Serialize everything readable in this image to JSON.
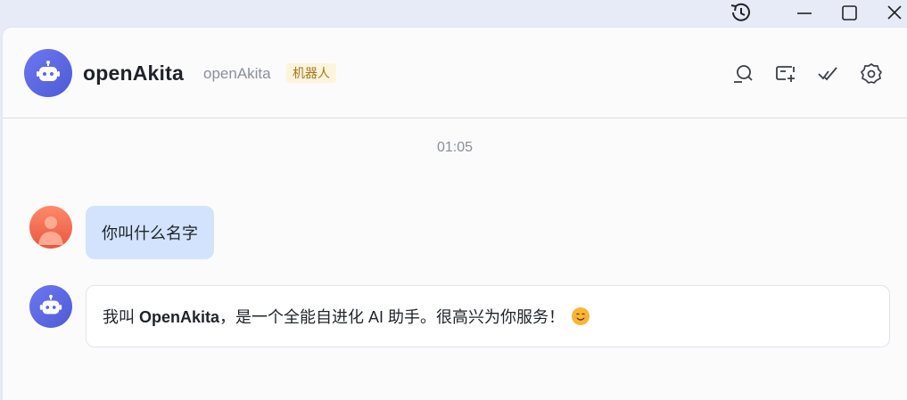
{
  "window": {
    "controls": {
      "history_icon": "history-icon",
      "minimize_icon": "minimize-icon",
      "maximize_icon": "maximize-icon",
      "close_icon": "close-icon"
    }
  },
  "header": {
    "title": "openAkita",
    "subtitle": "openAkita",
    "badge": "机器人",
    "actions": [
      "search-chat-icon",
      "new-chat-icon",
      "mark-read-icon",
      "settings-icon"
    ]
  },
  "chat": {
    "timestamp": "01:05",
    "messages": [
      {
        "role": "user",
        "text": "你叫什么名字"
      },
      {
        "role": "bot",
        "prefix": "我叫 ",
        "name": "OpenAkita",
        "suffix": "，是一个全能自进化 AI 助手。很高兴为你服务！",
        "emoji": "smiling-face-emoji"
      }
    ]
  },
  "colors": {
    "brand_avatar": "#5a66e6",
    "user_bubble": "#d3e3fd",
    "badge_bg": "#fdf4dc",
    "badge_text": "#a6761d"
  }
}
